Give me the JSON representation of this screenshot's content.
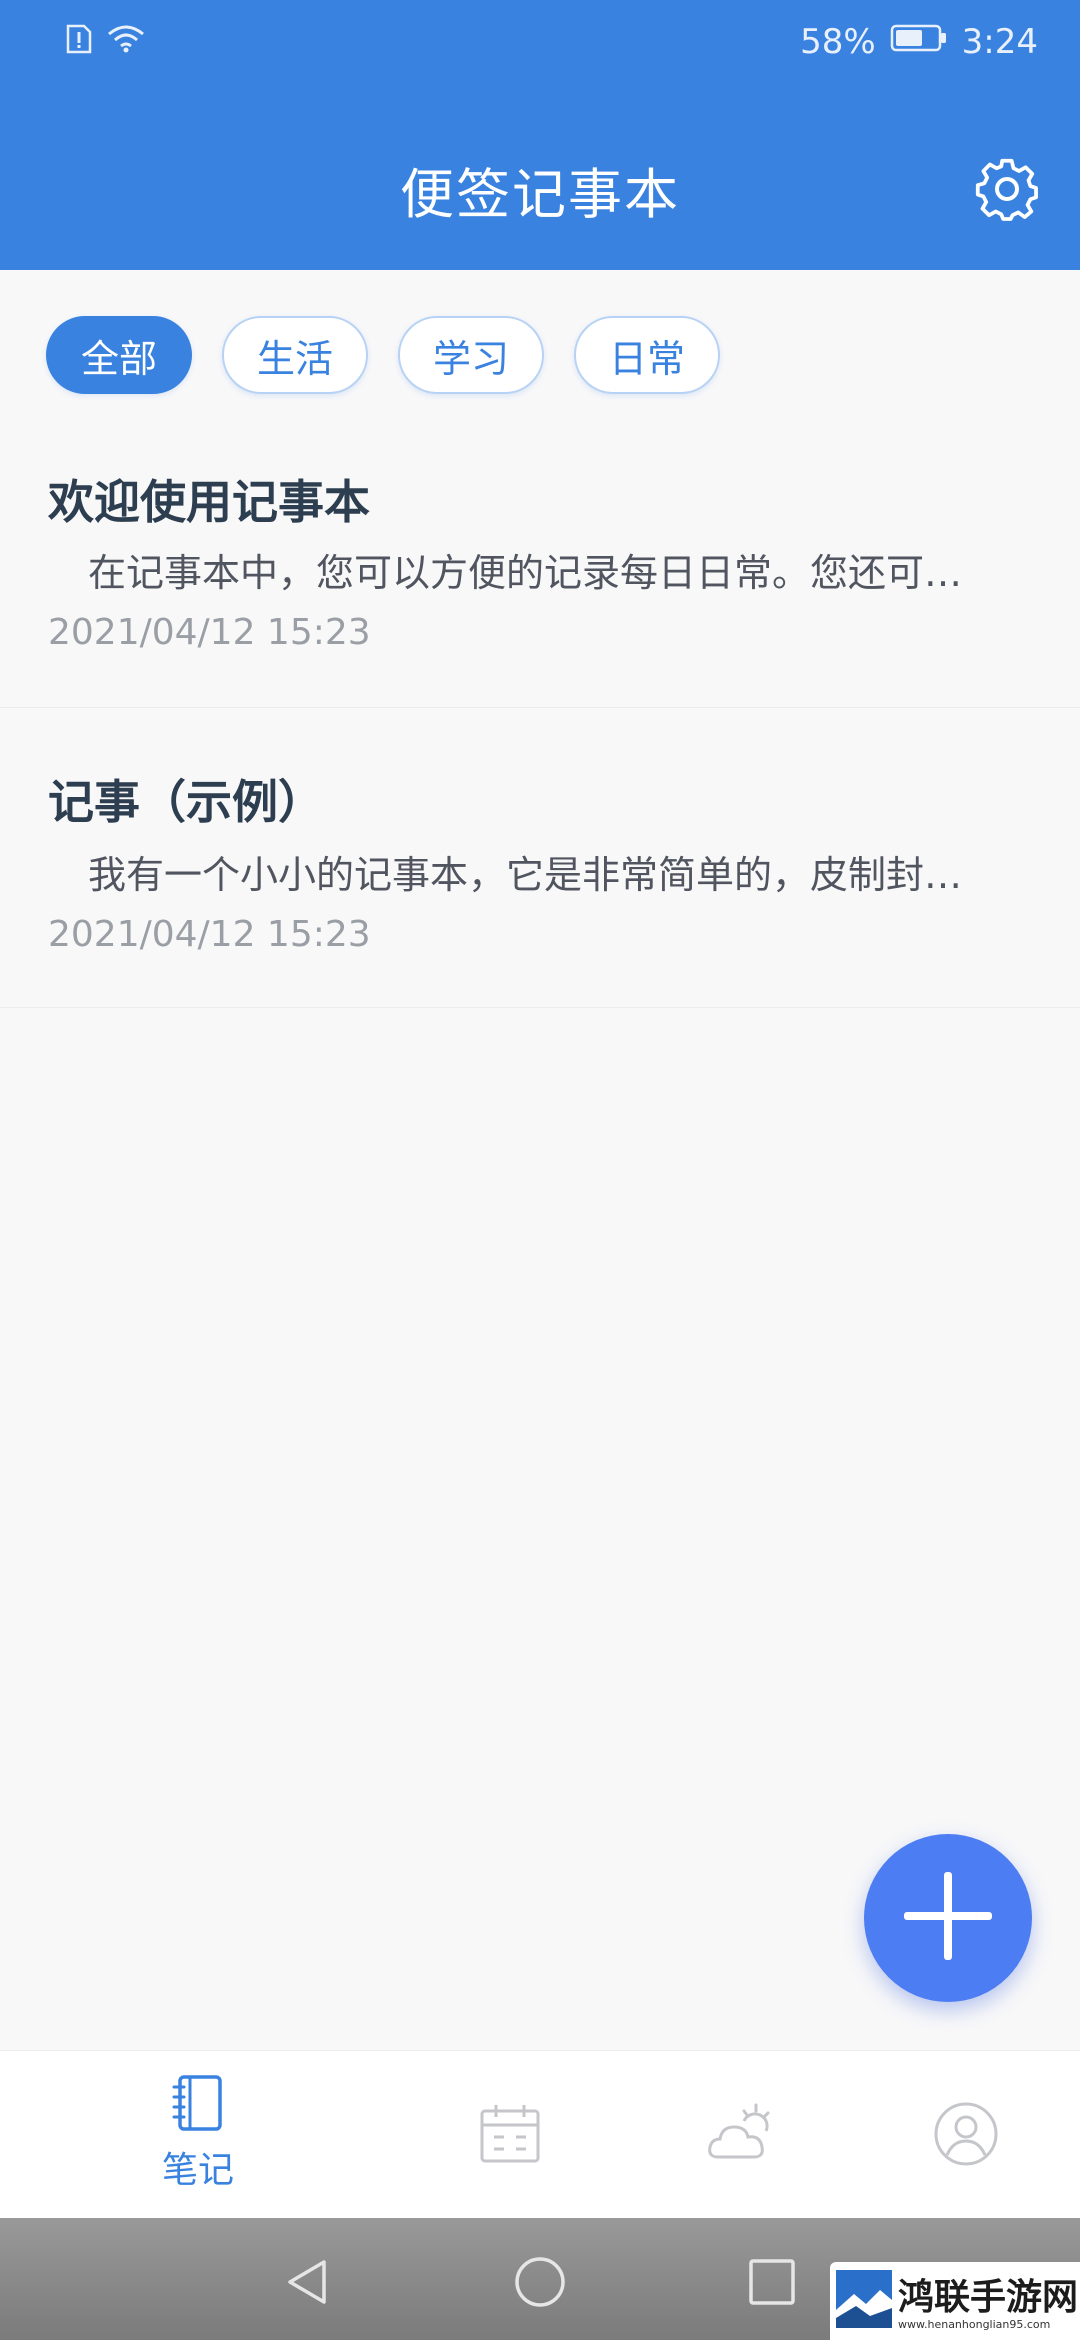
{
  "status_bar": {
    "battery": "58%",
    "time": "3:24",
    "icons": [
      "alert-sim-icon",
      "wifi-icon",
      "battery-icon"
    ]
  },
  "header": {
    "title": "便签记事本",
    "settings_icon": "gear-icon"
  },
  "tabs": [
    {
      "label": "全部",
      "active": true
    },
    {
      "label": "生活",
      "active": false
    },
    {
      "label": "学习",
      "active": false
    },
    {
      "label": "日常",
      "active": false
    }
  ],
  "notes": [
    {
      "title": "欢迎使用记事本",
      "body": "在记事本中，您可以方便的记录每日日常。您还可以按分类查看记事。",
      "date": "2021/04/12 15:23"
    },
    {
      "title": "记事（示例）",
      "body": "我有一个小小的记事本，它是非常简单的，皮制封面。",
      "date": "2021/04/12 15:23"
    }
  ],
  "fab": {
    "icon": "plus-icon"
  },
  "bottom_nav": [
    {
      "label": "笔记",
      "icon": "notebook-icon",
      "active": true
    },
    {
      "label": "",
      "icon": "calendar-icon",
      "active": false
    },
    {
      "label": "",
      "icon": "weather-icon",
      "active": false
    },
    {
      "label": "",
      "icon": "user-icon",
      "active": false
    }
  ],
  "system_nav": [
    "back-icon",
    "home-icon",
    "recents-icon"
  ],
  "watermark": {
    "text": "鸿联手游网",
    "url": "www.henanhonglian95.com"
  },
  "colors": {
    "primary": "#3a82e0",
    "fab": "#4d7df2",
    "background": "#f8f8f9"
  }
}
